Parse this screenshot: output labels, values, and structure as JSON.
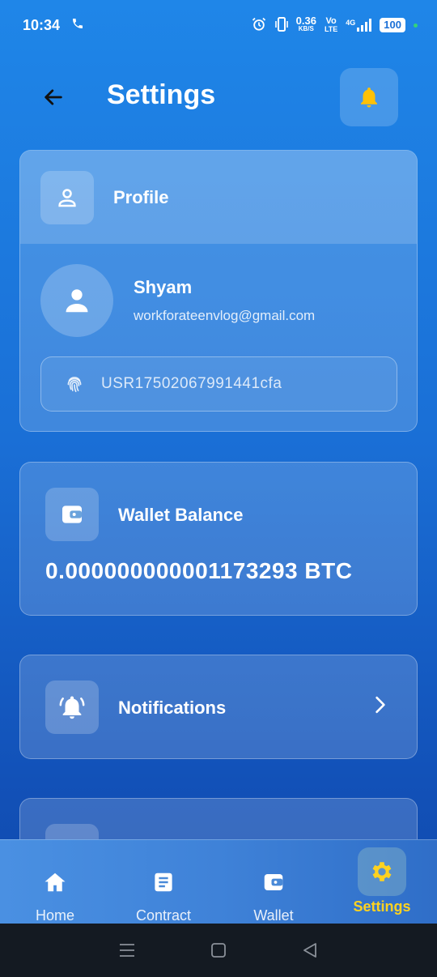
{
  "status_bar": {
    "time": "10:34",
    "speed_value": "0.36",
    "speed_unit": "KB/S",
    "volte_top": "Vo",
    "volte_bottom": "LTE",
    "network": "4G",
    "battery": "100"
  },
  "header": {
    "title": "Settings",
    "back_icon": "arrow-left-icon",
    "bell_icon": "bell-icon",
    "bell_color": "#ffc107"
  },
  "profile": {
    "section_title": "Profile",
    "name": "Shyam",
    "email": "workforateenvlog@gmail.com",
    "user_id": "USR17502067991441cfa"
  },
  "wallet": {
    "title": "Wallet Balance",
    "balance": "0.000000000001173293 BTC"
  },
  "notifications": {
    "title": "Notifications"
  },
  "nav": {
    "items": [
      {
        "label": "Home",
        "icon": "home-icon"
      },
      {
        "label": "Contract",
        "icon": "document-icon"
      },
      {
        "label": "Wallet",
        "icon": "wallet-icon"
      },
      {
        "label": "Settings",
        "icon": "gear-icon"
      }
    ],
    "active": "Settings",
    "active_color": "#ffd21f"
  }
}
